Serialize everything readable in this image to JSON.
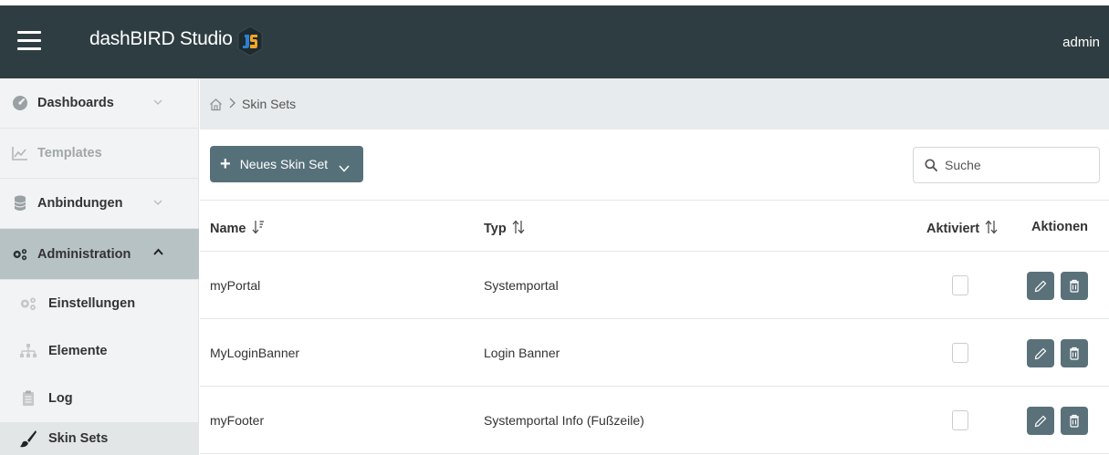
{
  "header": {
    "title": "dashBIRD Studio",
    "user": "admin",
    "menu_icon": "hamburger-menu-icon",
    "logo_icon": "dashbird-logo-icon"
  },
  "sidebar": {
    "items": [
      {
        "label": "Dashboards",
        "icon": "dashboard-gauge-icon",
        "expandable": true
      },
      {
        "label": "Templates",
        "icon": "chart-line-icon",
        "expandable": false
      },
      {
        "label": "Anbindungen",
        "icon": "database-icon",
        "expandable": true
      },
      {
        "label": "Administration",
        "icon": "cogs-icon",
        "expandable": true,
        "expanded": true
      }
    ],
    "subitems": [
      {
        "label": "Einstellungen",
        "icon": "cogs-icon"
      },
      {
        "label": "Elemente",
        "icon": "sitemap-icon"
      },
      {
        "label": "Log",
        "icon": "clipboard-icon"
      },
      {
        "label": "Skin Sets",
        "icon": "paintbrush-icon",
        "selected": true
      }
    ]
  },
  "breadcrumb": {
    "home_icon": "home-icon",
    "current": "Skin Sets"
  },
  "toolbar": {
    "new_label": "Neues Skin Set",
    "search_placeholder": "Suche"
  },
  "table": {
    "columns": {
      "name": "Name",
      "type": "Typ",
      "active": "Aktiviert",
      "actions": "Aktionen"
    },
    "rows": [
      {
        "name": "myPortal",
        "type": "Systemportal",
        "active": false
      },
      {
        "name": "MyLoginBanner",
        "type": "Login Banner",
        "active": false
      },
      {
        "name": "myFooter",
        "type": "Systemportal Info (Fußzeile)",
        "active": false
      }
    ]
  },
  "colors": {
    "header_bg": "#2e3d42",
    "accent": "#56707a",
    "sidebar_active": "#b7c2c4",
    "logo_blue": "#2f7fd1",
    "logo_orange": "#f5a623"
  }
}
